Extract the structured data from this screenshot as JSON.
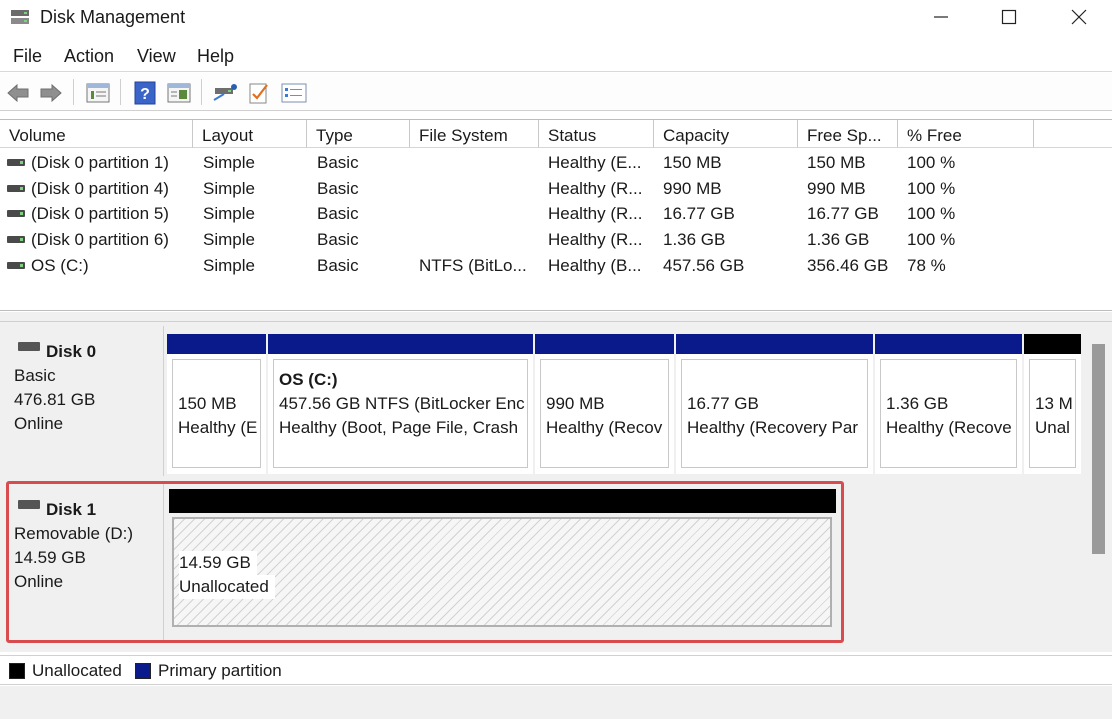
{
  "window": {
    "title": "Disk Management",
    "app_icon": "disk-management-icon"
  },
  "menu": [
    "File",
    "Action",
    "View",
    "Help"
  ],
  "toolbar_icons": [
    "back-icon",
    "forward-icon",
    "properties-list-icon",
    "help-icon",
    "view-icon",
    "connect-icon",
    "check-icon",
    "list-icon"
  ],
  "volume_table": {
    "columns": [
      "Volume",
      "Layout",
      "Type",
      "File System",
      "Status",
      "Capacity",
      "Free Sp...",
      "% Free"
    ],
    "rows": [
      [
        "(Disk 0 partition 1)",
        "Simple",
        "Basic",
        "",
        "Healthy (E...",
        "150 MB",
        "150 MB",
        "100 %"
      ],
      [
        "(Disk 0 partition 4)",
        "Simple",
        "Basic",
        "",
        "Healthy (R...",
        "990 MB",
        "990 MB",
        "100 %"
      ],
      [
        "(Disk 0 partition 5)",
        "Simple",
        "Basic",
        "",
        "Healthy (R...",
        "16.77 GB",
        "16.77 GB",
        "100 %"
      ],
      [
        "(Disk 0 partition 6)",
        "Simple",
        "Basic",
        "",
        "Healthy (R...",
        "1.36 GB",
        "1.36 GB",
        "100 %"
      ],
      [
        "OS (C:)",
        "Simple",
        "Basic",
        "NTFS (BitLo...",
        "Healthy (B...",
        "457.56 GB",
        "356.46 GB",
        "78 %"
      ]
    ]
  },
  "disks": [
    {
      "name": "Disk 0",
      "type": "Basic",
      "size": "476.81 GB",
      "status": "Online",
      "partitions": [
        {
          "lines": [
            "150 MB",
            "Healthy (E"
          ]
        },
        {
          "title": "OS  (C:)",
          "lines": [
            "457.56 GB NTFS (BitLocker Enc",
            "Healthy (Boot, Page File, Crash"
          ]
        },
        {
          "lines": [
            "990 MB",
            "Healthy (Recov"
          ]
        },
        {
          "lines": [
            "16.77 GB",
            "Healthy (Recovery Par"
          ]
        },
        {
          "lines": [
            "1.36 GB",
            "Healthy (Recove"
          ]
        },
        {
          "lines": [
            "13 M",
            "Unal"
          ]
        }
      ]
    },
    {
      "name": "Disk 1",
      "type": "Removable (D:)",
      "size": "14.59 GB",
      "status": "Online",
      "partitions": [
        {
          "lines": [
            "14.59 GB",
            "Unallocated"
          ]
        }
      ]
    }
  ],
  "legend": [
    {
      "label": "Unallocated",
      "color": "#000000"
    },
    {
      "label": "Primary partition",
      "color": "#0a1a8a"
    }
  ],
  "colors": {
    "primary": "#0a1a8a",
    "unallocated": "#000000",
    "highlight": "#d84c50"
  }
}
